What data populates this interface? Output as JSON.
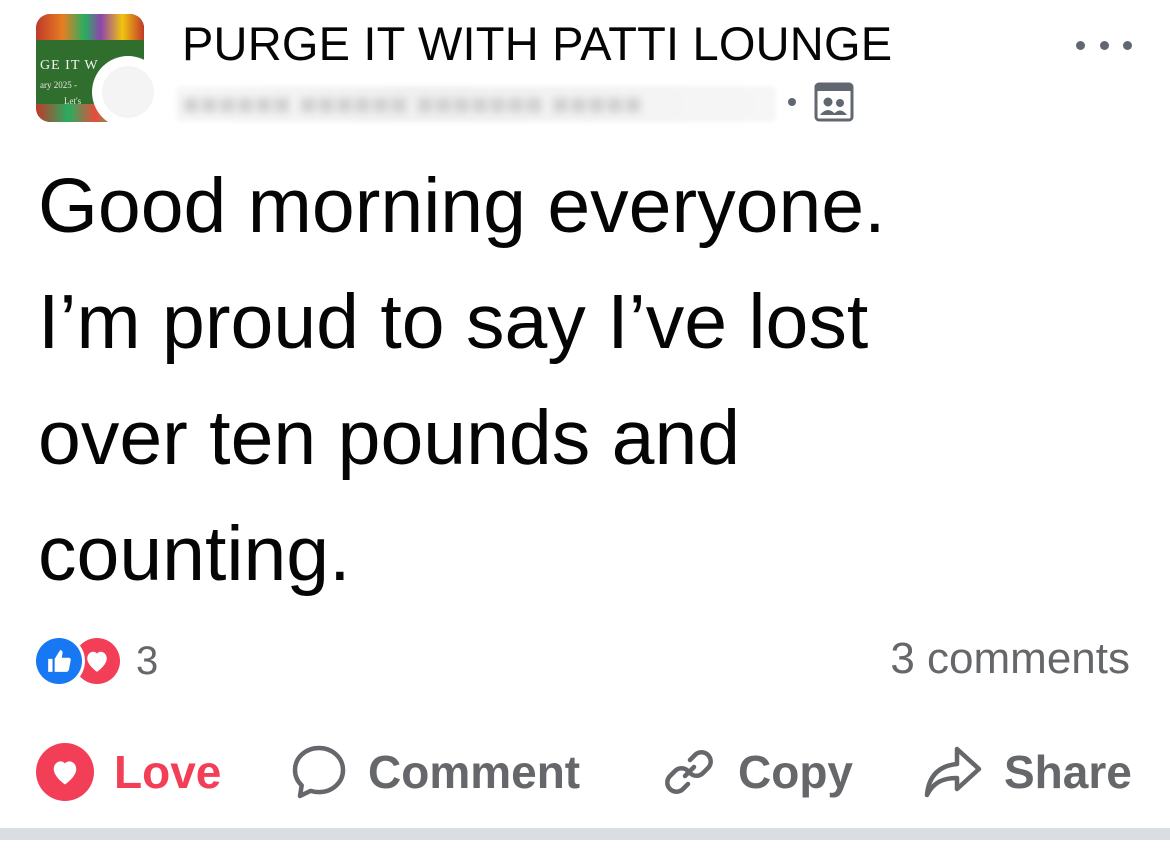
{
  "group": {
    "name": "PURGE IT WITH PATTI LOUNGE",
    "avatar_line1": "GE IT W",
    "avatar_line2": "ary 2025 -",
    "avatar_line3": "Let's"
  },
  "author": {
    "name_obscured": "■■■■■■ ■■■■■■ ■■■■■■■ ■■■■■"
  },
  "icons": {
    "menu": "more-horizontal-icon",
    "audience": "group-members-icon",
    "like": "thumbs-up-icon",
    "love": "heart-icon",
    "comment": "speech-bubble-icon",
    "copy": "link-icon",
    "share": "share-arrow-icon"
  },
  "post": {
    "text": "Good morning everyone.\nI’m proud to say I’ve lost\nover ten pounds and\ncounting."
  },
  "stats": {
    "reaction_count": "3",
    "comments_label": "3 comments"
  },
  "actions": {
    "love": "Love",
    "comment": "Comment",
    "copy": "Copy",
    "share": "Share"
  },
  "colors": {
    "love": "#f33e58",
    "like": "#1877f2",
    "muted": "#65676b"
  }
}
